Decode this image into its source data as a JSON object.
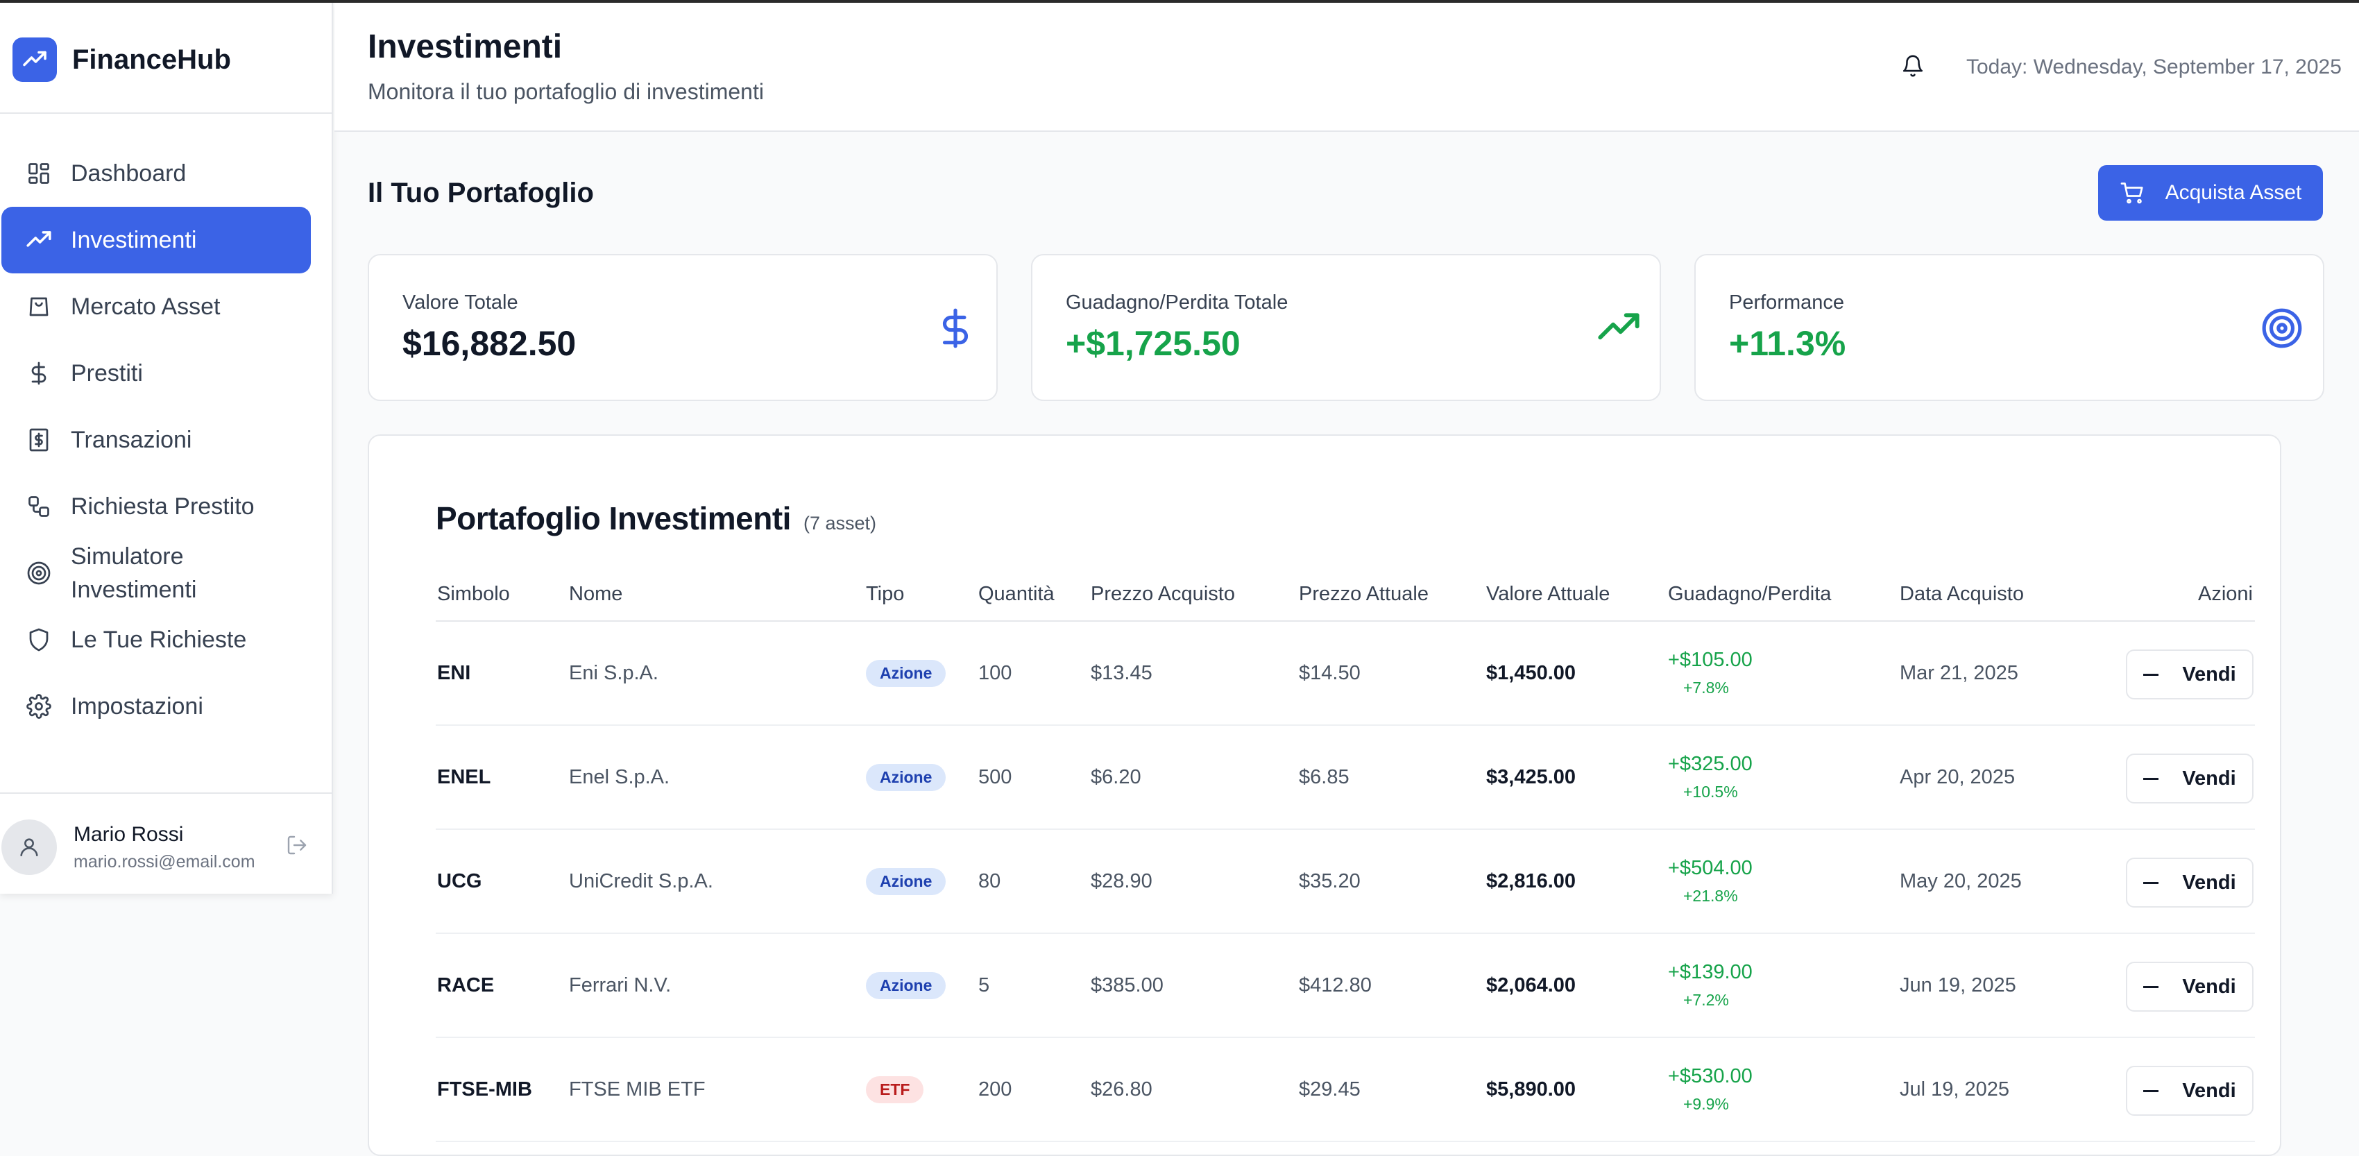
{
  "app": {
    "name": "FinanceHub"
  },
  "sidebar": {
    "items": [
      {
        "label": "Dashboard",
        "icon": "dashboard-icon",
        "active": false
      },
      {
        "label": "Investimenti",
        "icon": "trending-up-icon",
        "active": true
      },
      {
        "label": "Mercato Asset",
        "icon": "shopping-bag-icon",
        "active": false
      },
      {
        "label": "Prestiti",
        "icon": "dollar-icon",
        "active": false
      },
      {
        "label": "Transazioni",
        "icon": "receipt-icon",
        "active": false
      },
      {
        "label": "Richiesta Prestito",
        "icon": "workflow-icon",
        "active": false
      },
      {
        "label": "Simulatore\nInvestimenti",
        "icon": "target-icon",
        "active": false
      },
      {
        "label": "Le Tue Richieste",
        "icon": "shield-icon",
        "active": false
      },
      {
        "label": "Impostazioni",
        "icon": "gear-icon",
        "active": false
      }
    ],
    "user": {
      "name": "Mario Rossi",
      "email": "mario.rossi@email.com"
    }
  },
  "header": {
    "title": "Investimenti",
    "subtitle": "Monitora il tuo portafoglio di investimenti",
    "today": "Today: Wednesday, September 17, 2025"
  },
  "main": {
    "section_title": "Il Tuo Portafoglio",
    "buy_label": "Acquista Asset",
    "cards": [
      {
        "label": "Valore Totale",
        "value": "$16,882.50",
        "icon": "dollar-icon",
        "color": "#111827"
      },
      {
        "label": "Guadagno/Perdita Totale",
        "value": "+$1,725.50",
        "icon": "trending-up-icon",
        "color": "#16a34a"
      },
      {
        "label": "Performance",
        "value": "+11.3%",
        "icon": "target-icon",
        "color": "#16a34a"
      }
    ],
    "table": {
      "title": "Portafoglio Investimenti",
      "count": "(7 asset)",
      "headers": [
        "Simbolo",
        "Nome",
        "Tipo",
        "Quantità",
        "Prezzo Acquisto",
        "Prezzo Attuale",
        "Valore Attuale",
        "Guadagno/Perdita",
        "Data Acquisto",
        "Azioni"
      ],
      "sell_label": "Vendi",
      "rows": [
        {
          "symbol": "ENI",
          "name": "Eni S.p.A.",
          "type": "Azione",
          "qty": "100",
          "buy": "$13.45",
          "current": "$14.50",
          "value": "$1,450.00",
          "gain": "+$105.00",
          "gain_pct": "+7.8%",
          "date": "Mar 21, 2025"
        },
        {
          "symbol": "ENEL",
          "name": "Enel S.p.A.",
          "type": "Azione",
          "qty": "500",
          "buy": "$6.20",
          "current": "$6.85",
          "value": "$3,425.00",
          "gain": "+$325.00",
          "gain_pct": "+10.5%",
          "date": "Apr 20, 2025"
        },
        {
          "symbol": "UCG",
          "name": "UniCredit S.p.A.",
          "type": "Azione",
          "qty": "80",
          "buy": "$28.90",
          "current": "$35.20",
          "value": "$2,816.00",
          "gain": "+$504.00",
          "gain_pct": "+21.8%",
          "date": "May 20, 2025"
        },
        {
          "symbol": "RACE",
          "name": "Ferrari N.V.",
          "type": "Azione",
          "qty": "5",
          "buy": "$385.00",
          "current": "$412.80",
          "value": "$2,064.00",
          "gain": "+$139.00",
          "gain_pct": "+7.2%",
          "date": "Jun 19, 2025"
        },
        {
          "symbol": "FTSE-MIB",
          "name": "FTSE MIB ETF",
          "type": "ETF",
          "qty": "200",
          "buy": "$26.80",
          "current": "$29.45",
          "value": "$5,890.00",
          "gain": "+$530.00",
          "gain_pct": "+9.9%",
          "date": "Jul 19, 2025"
        }
      ]
    }
  },
  "colors": {
    "accent": "#3b63e6",
    "gain": "#16a34a"
  }
}
